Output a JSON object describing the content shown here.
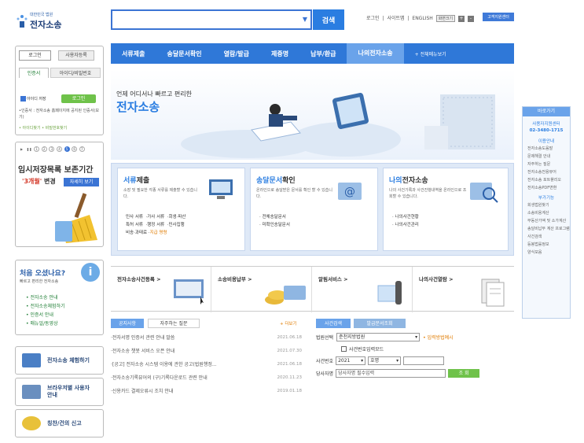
{
  "header": {
    "logo_sub": "대한민국 법원",
    "logo_main": "전자소송",
    "search_placeholder": "",
    "search_button": "검색",
    "top_links": [
      "로그인",
      "|",
      "사이트맵",
      "|",
      "ENGLISH"
    ],
    "text_size_label": "화면크기",
    "plus": "+",
    "minus": "-",
    "helpdesk_button": "고객지원센터"
  },
  "nav": {
    "items": [
      "서류제출",
      "송달문서확인",
      "열람/발급",
      "제증명",
      "납부/환급",
      "나의전자소송"
    ],
    "all_menu": "+ 전체메뉴보기"
  },
  "login": {
    "tab_login": "로그인",
    "tab_user": "사용자등록",
    "tab_cert": "인증서",
    "tab_idpw": "아이디/비밀번호",
    "remember_id": "아이디 저장",
    "login_button": "로그인",
    "notice": "•인증서 : 전자소송 홈페이지에 공지된 인증서(보기)",
    "find_id": "• 아이디찾기",
    "find_pw": "• 비밀번호찾기"
  },
  "temp_banner": {
    "pager": [
      "1",
      "2",
      "3",
      "4",
      "5",
      "6",
      "7"
    ],
    "title": "임시저장목록 보존기간",
    "months": "'3개월'",
    "change": "변경",
    "detail_button": "자세히 보기"
  },
  "first_visit": {
    "title": "처음 오셨나요?",
    "subtitle": "빠르고 편리한 전자소송",
    "icon_text": "i",
    "links": [
      "전자소송 안내",
      "전자소송체험하기",
      "인증서 안내",
      "매뉴얼/동영상"
    ]
  },
  "side_buttons": [
    "전자소송 체험하기",
    "브라우저별 사용자안내",
    "칭찬/건의 신고"
  ],
  "hero": {
    "line1": "언제 어디서나 빠르고 편리한",
    "line2": "전자소송"
  },
  "services": [
    {
      "title_bold": "서류",
      "title_rest": "제출",
      "desc": "소장 및 필요한 각종 서류를 제출할 수 있습니다.",
      "links": [
        [
          "민사 서류",
          "가사 서류",
          "회생·파산"
        ],
        [
          "특허 서류",
          "행정 서류",
          "민사집행"
        ],
        [
          "비송·과태료",
          "지급 명령",
          ""
        ]
      ]
    },
    {
      "title_bold": "송달문서",
      "title_rest": "확인",
      "desc": "온라인으로 송달받은 문서를 확인 할 수 있습니다.",
      "links": [
        [
          "전체송달문서"
        ],
        [
          "미확인송달문서"
        ]
      ]
    },
    {
      "title_bold": "나의",
      "title_rest": "전자소송",
      "desc": "나의 사건기록과 사건진행내역을 온라인으로 조회할 수 있습니다.",
      "links": [
        [
          "나의사건현황"
        ],
        [
          "나의사건관리"
        ]
      ]
    }
  ],
  "strip": [
    "전자소송사건등록 >",
    "소송비용납부 >",
    "알림서비스 >",
    "나의사건열람 >"
  ],
  "news": {
    "tab_notice": "공지사항",
    "tab_faq": "자주하는 질문",
    "more": "+ 더보기",
    "items": [
      {
        "title": "·전자서명 인증서 관련 안내 말씀",
        "date": "2021.06.18"
      },
      {
        "title": "·전자소송 챗봇 서비스 오픈 안내",
        "date": "2021.07.30"
      },
      {
        "title": "·[공고] 전자소송 시스템 이용에 관한 공고(법원행정...",
        "date": "2021.06.18"
      },
      {
        "title": "·전자소송기록뷰어의 (구)기록다운로드 관련 안내",
        "date": "2020.11.23"
      },
      {
        "title": "·신용카드 결제오류시 조치 안내",
        "date": "2019.01.18"
      }
    ]
  },
  "case_search": {
    "tab_case": "사건검색",
    "tab_doc": "발급문서조회",
    "court_label": "법원선택",
    "court_value": "춘천지방법원",
    "input_example": "입력방법예시",
    "case_no_input_mode": "사건번호입력모드",
    "case_no_label": "사건번호",
    "year": "2021",
    "type": "호명",
    "party_label": "당사자명",
    "party_placeholder": "당사자명 필수입력",
    "search_button": "조 회"
  },
  "quick": {
    "header": "바로가기",
    "center": "사용자지원센터",
    "phone": "02-3480-1715",
    "usage_title": "이용안내",
    "usage_links": [
      "전자소송도움말",
      "문제해결 안내",
      "자주하는 질문",
      "전자소송전용뷰어",
      "전자소송 포트폴리오",
      "전자소송PDF변환"
    ],
    "extra_title": "부가기능",
    "extra_links": [
      "회생법원찾기",
      "소송비용계산",
      "부동산가액 및 소가계산",
      "송달비납부 계산 프로그램",
      "사건검색",
      "등봉법률정보",
      "양식모음"
    ]
  }
}
